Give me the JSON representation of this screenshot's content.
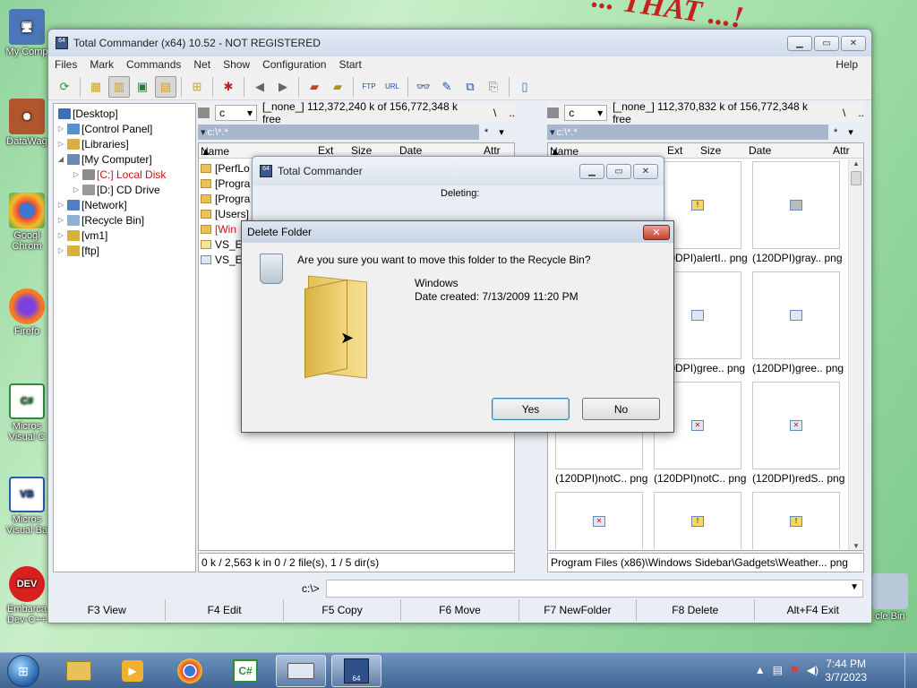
{
  "desktop": {
    "banner": "... THAT ...!",
    "icons_left": [
      {
        "label": "My Comp"
      },
      {
        "label": "DataWag"
      },
      {
        "label": "Googl Chrom"
      },
      {
        "label": "Firefo"
      },
      {
        "label": "Micros Visual C"
      },
      {
        "label": "Micros Visual Ba"
      },
      {
        "label": "Embarca Dev-C++"
      }
    ],
    "icons_right": [
      {
        "label": "cle Bin"
      }
    ]
  },
  "window": {
    "title": "Total Commander (x64) 10.52 - NOT REGISTERED"
  },
  "menu": [
    "Files",
    "Mark",
    "Commands",
    "Net",
    "Show",
    "Configuration",
    "Start"
  ],
  "menu_help": "Help",
  "tree": [
    {
      "label": "[Desktop]",
      "icon": "desktop-icon",
      "color": "#3c6fb5"
    },
    {
      "label": "[Control Panel]",
      "icon": "control-panel-icon",
      "color": "#5a8fd0"
    },
    {
      "label": "[Libraries]",
      "icon": "libraries-icon",
      "color": "#d9b040"
    },
    {
      "label": "[My Computer]",
      "icon": "computer-icon",
      "color": "#6a8ab4"
    },
    {
      "label": "[C:]  Local Disk",
      "icon": "drive-icon",
      "color": "#8c8c8c"
    },
    {
      "label": "[D:]  CD Drive",
      "icon": "cd-drive-icon",
      "color": "#9a9a9a"
    },
    {
      "label": "[Network]",
      "icon": "network-icon",
      "color": "#4f7fc0"
    },
    {
      "label": "[Recycle Bin]",
      "icon": "recycle-bin-icon",
      "color": "#8fb0d0"
    },
    {
      "label": "[vm1]",
      "icon": "share-icon",
      "color": "#d9b040"
    },
    {
      "label": "[ftp]",
      "icon": "ftp-icon",
      "color": "#d9b040"
    }
  ],
  "left_panel": {
    "drive": "c",
    "drive_info": "[_none_]  112,372,240 k of 156,772,348 k free",
    "root": "\\",
    "up": "..",
    "path": "c:\\*.*",
    "filter": "*",
    "columns": [
      "Name",
      "Ext",
      "Size",
      "Date",
      "Attr"
    ],
    "rows": [
      "[PerfLo",
      "[Progra",
      "[Progra",
      "[Users]",
      "[Win",
      "VS_EX",
      "VS_EX"
    ],
    "status": "0 k / 2,563 k in 0 / 2 file(s), 1 / 5 dir(s)"
  },
  "right_panel": {
    "drive": "c",
    "drive_info": "[_none_]  112,370,832 k of 156,772,348 k free",
    "root": "\\",
    "up": "..",
    "path": "c:\\*.*",
    "filter": "*",
    "columns": [
      "Name",
      "Ext",
      "Size",
      "Date",
      "Attr"
    ],
    "captions": [
      "(120DPI)alertI.. png",
      "(120DPI)gray.. png",
      "(120DPI)gree.. png",
      "(120DPI)gree.. png",
      "(120DPI)notC.. png",
      "(120DPI)notC.. png",
      "(120DPI)redS.. png"
    ],
    "status": "Program Files (x86)\\Windows Sidebar\\Gadgets\\Weather... png"
  },
  "cmd": {
    "prompt": "c:\\>"
  },
  "fkeys": [
    "F3 View",
    "F4 Edit",
    "F5 Copy",
    "F6 Move",
    "F7 NewFolder",
    "F8 Delete",
    "Alt+F4 Exit"
  ],
  "progress_dialog": {
    "title": "Total Commander",
    "message": "Deleting:"
  },
  "delete_dialog": {
    "title": "Delete Folder",
    "question": "Are you sure you want to move this folder to the Recycle Bin?",
    "name": "Windows",
    "date": "Date created: 7/13/2009 11:20 PM",
    "yes": "Yes",
    "no": "No"
  },
  "taskbar": {
    "time": "7:44 PM",
    "date": "3/7/2023"
  }
}
